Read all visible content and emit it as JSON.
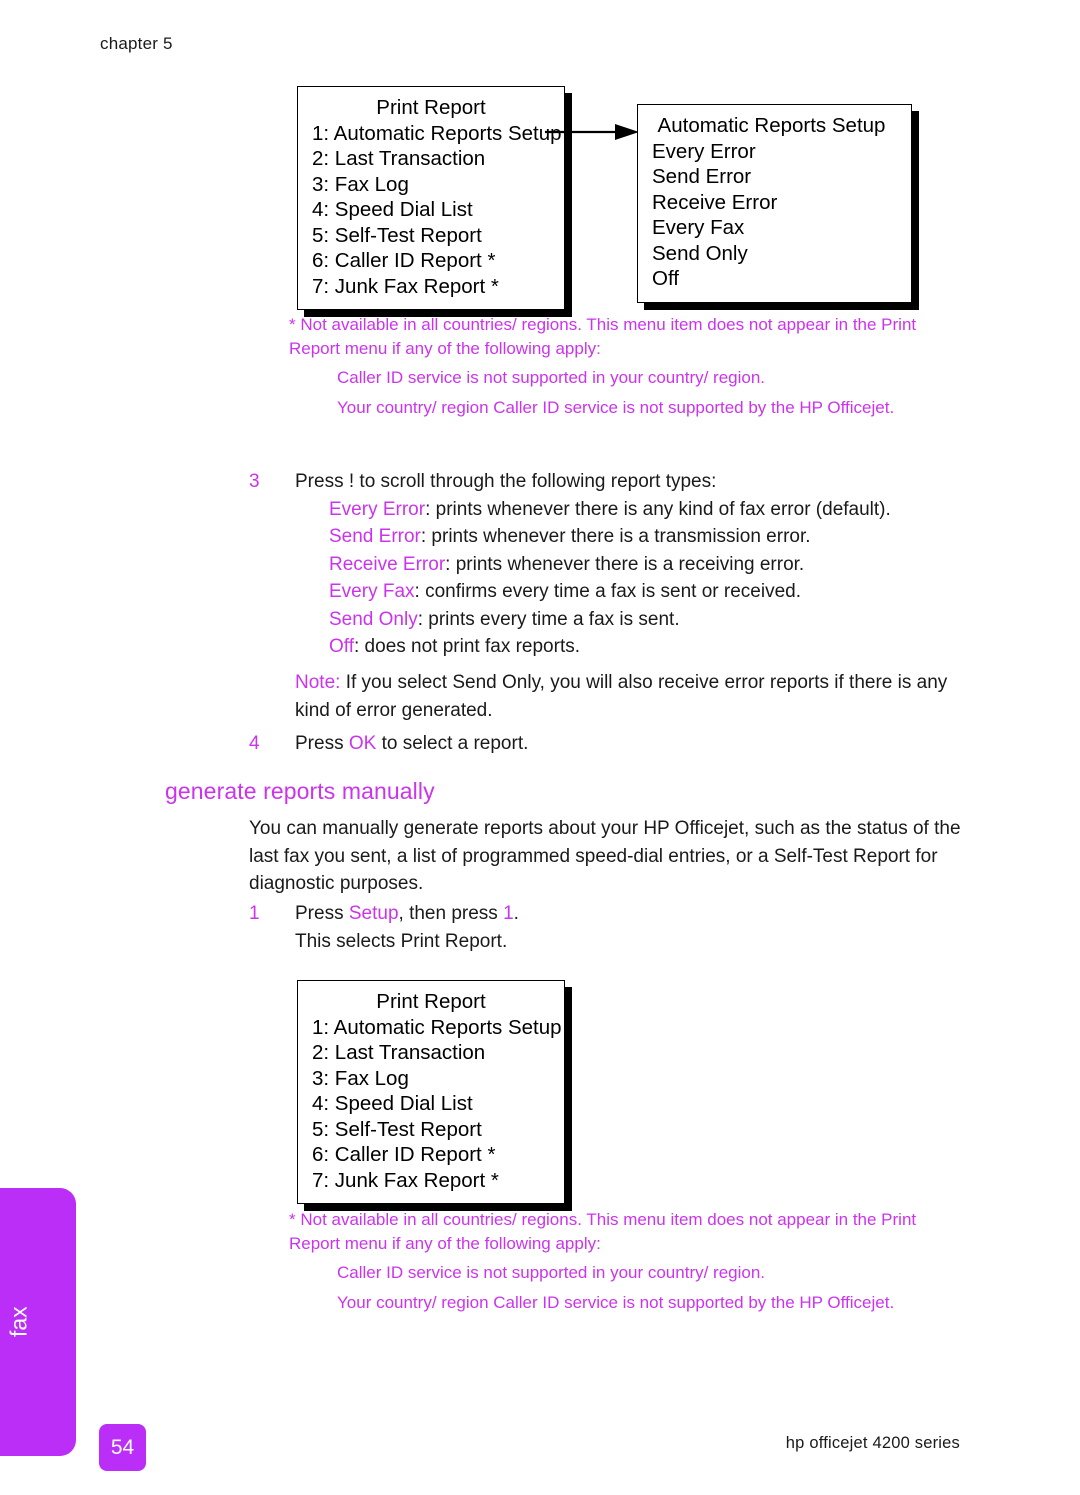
{
  "header": {
    "chapter_label": "chapter 5"
  },
  "lcd_box_1": {
    "name": "print-report-menu",
    "title": "Print Report",
    "lines": [
      "1: Automatic Reports Setup",
      "2: Last Transaction",
      "3: Fax Log",
      "4: Speed Dial List",
      "5: Self-Test Report",
      "6: Caller ID Report *",
      "7: Junk Fax Report *"
    ]
  },
  "lcd_box_2": {
    "name": "automatic-reports-setup-menu",
    "title": "Automatic Reports Setup",
    "lines": [
      "Every Error",
      "Send Error",
      "Receive Error",
      "Every Fax",
      "Send Only",
      "Off"
    ]
  },
  "lcd_box_3": {
    "name": "print-report-menu-second",
    "title": "Print Report",
    "lines": [
      "1: Automatic Reports Setup",
      "2: Last Transaction",
      "3: Fax Log",
      "4: Speed Dial List",
      "5: Self-Test Report",
      "6: Caller ID Report *",
      "7: Junk Fax Report *"
    ]
  },
  "footnote_1": {
    "head": "*  Not available in all countries/ regions. This menu item does not appear in the Print Report menu if any of the following apply:",
    "sub1": "Caller ID service is not supported in your country/ region.",
    "sub2": "Your country/ region Caller ID service is not supported by the HP Officejet."
  },
  "footnote_2": {
    "head": "*  Not available in all countries/ regions. This menu item does not appear in the Print Report menu if any of the following apply:",
    "sub1": "Caller ID service is not supported in your country/ region.",
    "sub2": "Your country/ region Caller ID service is not supported by the HP Officejet."
  },
  "step_3": {
    "number": "3",
    "lead_before": "Press ",
    "lead_key": "!",
    "lead_after": "  to scroll through the following report types:",
    "items": [
      {
        "term": "Every Error",
        "desc": ": prints whenever there is any kind of fax error (default)."
      },
      {
        "term": "Send Error",
        "desc": ": prints whenever there is a transmission error."
      },
      {
        "term": "Receive Error",
        "desc": ": prints whenever there is a receiving error."
      },
      {
        "term": "Every Fax",
        "desc": ": confirms every time a fax is sent or received."
      },
      {
        "term": "Send Only",
        "desc": ": prints every time a fax is sent."
      },
      {
        "term": "Off",
        "desc": ": does not print fax reports."
      }
    ]
  },
  "note_block": {
    "label": "Note:",
    "text": "  If you select Send Only, you will also receive error reports if there is any kind of error generated."
  },
  "step_4": {
    "number": "4",
    "before": "Press ",
    "key": "OK",
    "after": " to select a report."
  },
  "section_heading": "generate reports manually",
  "intro_paragraph": "You can manually generate reports about your HP Officejet, such as the status of the last fax you sent, a list of programmed speed-dial entries, or a Self-Test Report for diagnostic purposes.",
  "step_1": {
    "number": "1",
    "before": "Press ",
    "key": "Setup",
    "middle": ", then press ",
    "key2": "1",
    "after": ".",
    "second_line": "This selects Print Report."
  },
  "side_tab": {
    "label": "fax"
  },
  "page_badge": "54",
  "footer_text": "hp officejet 4200 series",
  "colors": {
    "magenta_text": "#cc33ee",
    "tab_fill": "#ba2ef8",
    "body_text": "#1a1a1a"
  }
}
